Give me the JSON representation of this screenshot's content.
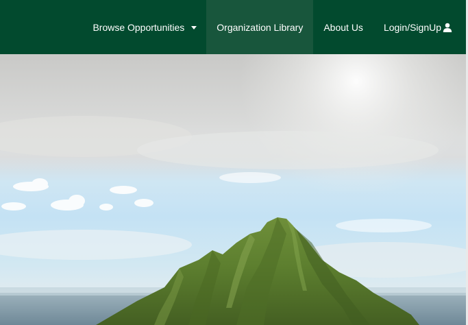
{
  "navbar": {
    "items": [
      {
        "label": "Browse Opportunities",
        "has_dropdown": true,
        "active": false
      },
      {
        "label": "Organization Library",
        "active": true
      },
      {
        "label": "About Us",
        "active": false
      },
      {
        "label": "Login/SignUp",
        "icon": "user-icon",
        "active": false
      }
    ]
  },
  "hero": {
    "image": "mountain-peak-landscape"
  },
  "colors": {
    "navbar_bg": "#024a2e",
    "active_item_bg": "#18563c",
    "nav_text": "#ffffff"
  }
}
